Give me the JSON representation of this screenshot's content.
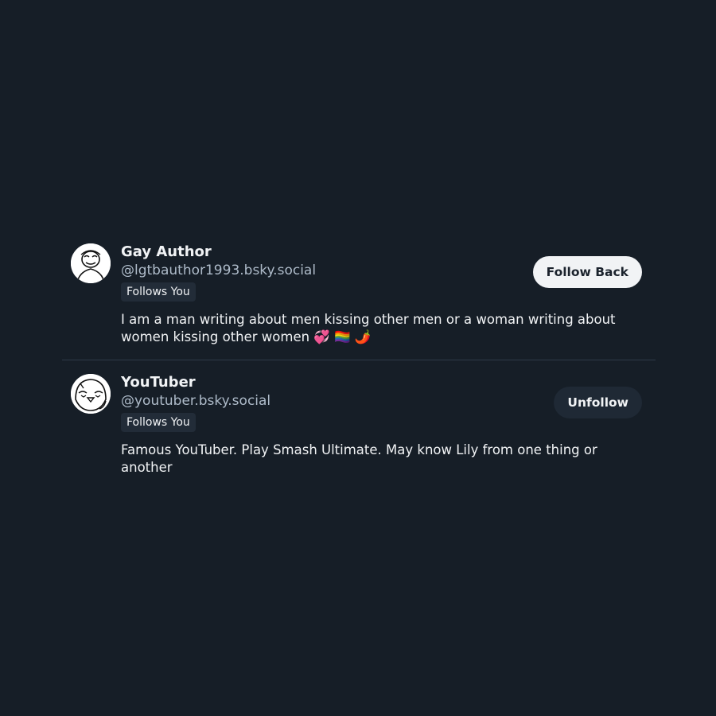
{
  "users": [
    {
      "name": "Gay Author",
      "handle": "@lgtbauthor1993.bsky.social",
      "badge": "Follows You",
      "bio": "I am a man writing about men kissing other men or a woman writing about women kissing other women 💞 🏳️‍🌈 🌶️",
      "button": "Follow Back",
      "avatar_icon": "cartoon-face-avatar"
    },
    {
      "name": "YouTuber",
      "handle": "@youtuber.bsky.social",
      "badge": "Follows You",
      "bio": "Famous YouTuber. Play Smash Ultimate. May know Lily from one thing or another",
      "button": "Unfollow",
      "avatar_icon": "cartoon-bird-avatar"
    }
  ]
}
